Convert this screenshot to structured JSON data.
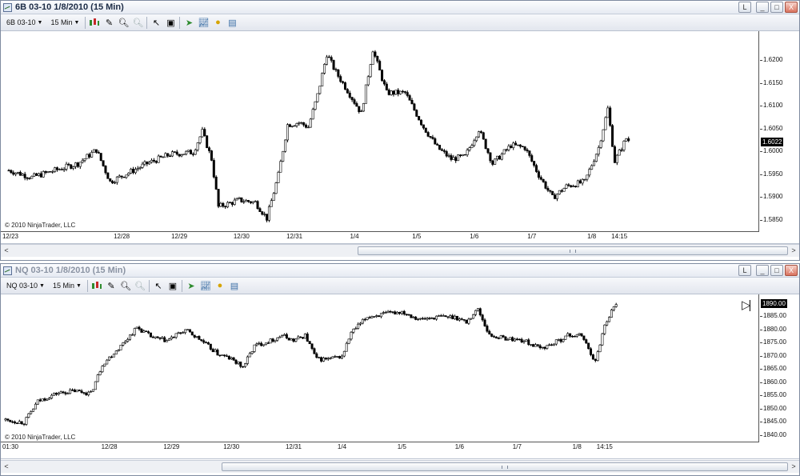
{
  "windows": [
    {
      "id": "w1",
      "title": "6B 03-10  1/8/2010 (15 Min)",
      "toolbar": {
        "instrument": "6B 03-10",
        "interval": "15 Min"
      },
      "buttons": {
        "link": "L",
        "minimize": "_",
        "maximize": "□",
        "close": "X"
      },
      "copyright": "© 2010 NinjaTrader, LLC",
      "last_price": "1.6022",
      "chart_data": {
        "type": "candlestick",
        "instrument": "6B 03-10",
        "interval": "15 Min",
        "y_ticks": [
          "1.6200",
          "1.6150",
          "1.6100",
          "1.6050",
          "1.6000",
          "1.5950",
          "1.5900",
          "1.5850"
        ],
        "ylim": [
          1.5825,
          1.6265
        ],
        "x_tick_labels": [
          "12/23",
          "12/28",
          "12/29",
          "12/30",
          "12/31",
          "1/4",
          "1/5",
          "1/6",
          "1/7",
          "1/8",
          "14:15"
        ],
        "x_tick_index": [
          0,
          49,
          74,
          101,
          124,
          150,
          177,
          202,
          227,
          253,
          265
        ],
        "bar_count": 270,
        "price_path": [
          [
            0,
            1.596
          ],
          [
            10,
            1.5945
          ],
          [
            20,
            1.596
          ],
          [
            30,
            1.5975
          ],
          [
            38,
            1.6005
          ],
          [
            44,
            1.5935
          ],
          [
            52,
            1.5955
          ],
          [
            60,
            1.5975
          ],
          [
            70,
            1.5995
          ],
          [
            80,
            1.6
          ],
          [
            84,
            1.6045
          ],
          [
            88,
            1.5985
          ],
          [
            91,
            1.588
          ],
          [
            100,
            1.5895
          ],
          [
            107,
            1.589
          ],
          [
            112,
            1.5855
          ],
          [
            117,
            1.595
          ],
          [
            121,
            1.606
          ],
          [
            126,
            1.6065
          ],
          [
            130,
            1.6055
          ],
          [
            134,
            1.6125
          ],
          [
            138,
            1.6215
          ],
          [
            142,
            1.6175
          ],
          [
            147,
            1.6135
          ],
          [
            153,
            1.6085
          ],
          [
            158,
            1.6225
          ],
          [
            164,
            1.613
          ],
          [
            172,
            1.613
          ],
          [
            180,
            1.6055
          ],
          [
            186,
            1.601
          ],
          [
            192,
            1.5985
          ],
          [
            198,
            1.599
          ],
          [
            204,
            1.605
          ],
          [
            210,
            1.5975
          ],
          [
            218,
            1.6015
          ],
          [
            224,
            1.601
          ],
          [
            230,
            1.595
          ],
          [
            236,
            1.59
          ],
          [
            242,
            1.5925
          ],
          [
            250,
            1.5935
          ],
          [
            256,
            1.601
          ],
          [
            260,
            1.6095
          ],
          [
            263,
            1.598
          ],
          [
            268,
            1.603
          ],
          [
            270,
            1.6022
          ]
        ]
      },
      "scrollbar": {
        "left": "<",
        "right": ">",
        "thumb_start": 0.445,
        "thumb_end": 1.0
      }
    },
    {
      "id": "w2",
      "title": "NQ 03-10  1/8/2010 (15 Min)",
      "toolbar": {
        "instrument": "NQ 03-10",
        "interval": "15 Min"
      },
      "buttons": {
        "link": "L",
        "minimize": "_",
        "maximize": "□",
        "close": "X"
      },
      "copyright": "© 2010 NinjaTrader, LLC",
      "last_price": "1890.00",
      "chart_data": {
        "type": "candlestick",
        "instrument": "NQ 03-10",
        "interval": "15 Min",
        "y_ticks": [
          "1885.00",
          "1880.00",
          "1875.00",
          "1870.00",
          "1865.00",
          "1860.00",
          "1855.00",
          "1850.00",
          "1845.00",
          "1840.00"
        ],
        "ylim": [
          1837.5,
          1893.5
        ],
        "x_tick_labels": [
          "01:30",
          "12/28",
          "12/29",
          "12/30",
          "12/31",
          "1/4",
          "1/5",
          "1/6",
          "1/7",
          "1/8",
          "14:15"
        ],
        "x_tick_index": [
          0,
          45,
          72,
          98,
          125,
          146,
          172,
          197,
          222,
          248,
          260
        ],
        "bar_count": 266,
        "price_path": [
          [
            0,
            1846
          ],
          [
            8,
            1845
          ],
          [
            14,
            1853
          ],
          [
            22,
            1856
          ],
          [
            30,
            1857
          ],
          [
            37,
            1856
          ],
          [
            42,
            1867
          ],
          [
            50,
            1874
          ],
          [
            57,
            1881
          ],
          [
            64,
            1877
          ],
          [
            70,
            1876
          ],
          [
            78,
            1880
          ],
          [
            85,
            1876
          ],
          [
            92,
            1871
          ],
          [
            98,
            1869
          ],
          [
            103,
            1866
          ],
          [
            108,
            1874
          ],
          [
            115,
            1876
          ],
          [
            120,
            1878
          ],
          [
            125,
            1876
          ],
          [
            130,
            1878
          ],
          [
            135,
            1869
          ],
          [
            140,
            1869
          ],
          [
            146,
            1870
          ],
          [
            150,
            1879
          ],
          [
            157,
            1885
          ],
          [
            164,
            1886
          ],
          [
            172,
            1887
          ],
          [
            180,
            1884
          ],
          [
            188,
            1885
          ],
          [
            195,
            1885
          ],
          [
            200,
            1883
          ],
          [
            205,
            1888
          ],
          [
            210,
            1878
          ],
          [
            216,
            1877
          ],
          [
            225,
            1876
          ],
          [
            232,
            1873
          ],
          [
            238,
            1875
          ],
          [
            244,
            1878
          ],
          [
            250,
            1878
          ],
          [
            256,
            1868
          ],
          [
            260,
            1882
          ],
          [
            264,
            1889
          ],
          [
            266,
            1890
          ]
        ]
      },
      "scrollbar": {
        "left": "<",
        "right": ">",
        "thumb_start": 0.27,
        "thumb_end": 1.0
      }
    }
  ]
}
